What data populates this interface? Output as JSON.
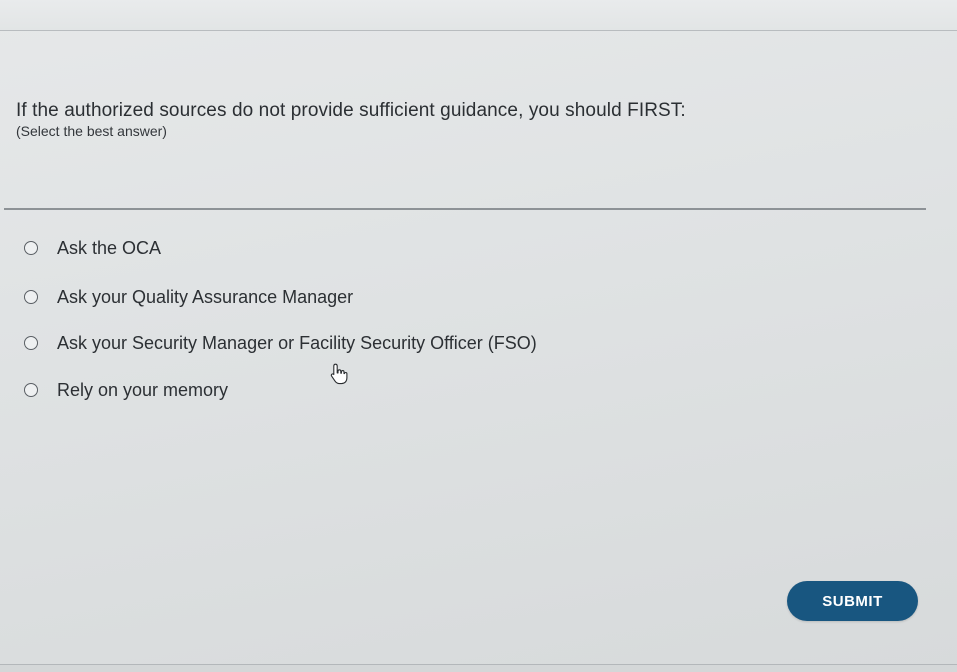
{
  "question": {
    "text": "If the authorized sources do not provide sufficient guidance, you should FIRST:",
    "instruction": "(Select the best answer)"
  },
  "answers": [
    {
      "label": "Ask the OCA",
      "selected": false
    },
    {
      "label": "Ask your Quality Assurance Manager",
      "selected": false
    },
    {
      "label": "Ask your Security Manager or Facility Security Officer (FSO)",
      "selected": false
    },
    {
      "label": "Rely on your memory",
      "selected": false
    }
  ],
  "submit": {
    "label": "SUBMIT"
  },
  "colors": {
    "submit_background": "#185680",
    "submit_text": "#ffffff",
    "page_background": "#e2e5e6",
    "text": "#2c3034"
  },
  "icons": {
    "cursor": "hand-pointer-icon",
    "radio": "radio-unchecked-icon"
  }
}
